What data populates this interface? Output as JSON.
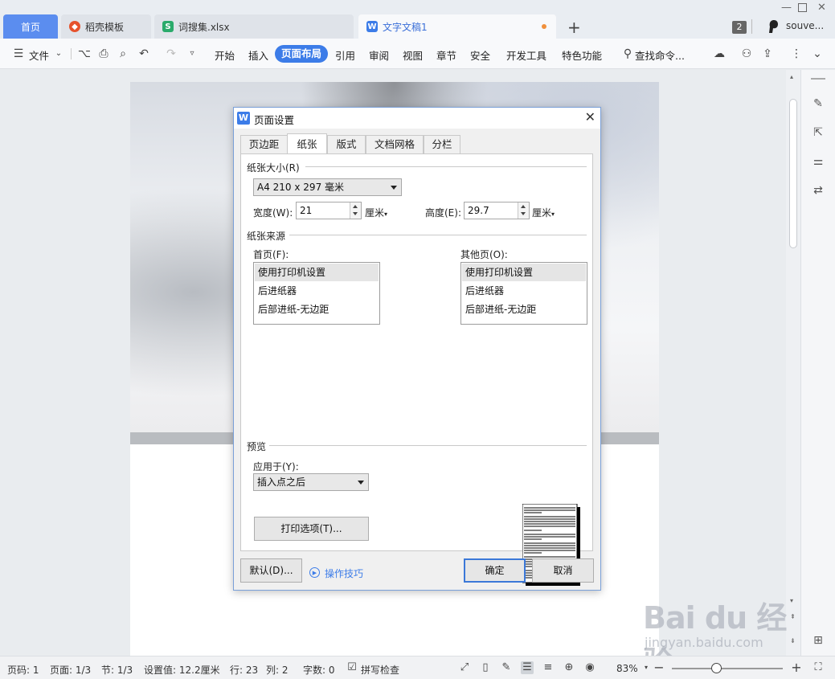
{
  "tabs": {
    "home": "首页",
    "daoke": "稻壳模板",
    "xlsx": "词搜集.xlsx",
    "doc": "文字文稿1",
    "window_count": "2",
    "user": "souve..."
  },
  "ribbon": {
    "file": "文件",
    "items": [
      "开始",
      "插入",
      "页面布局",
      "引用",
      "审阅",
      "视图",
      "章节",
      "安全",
      "开发工具",
      "特色功能"
    ],
    "active": "页面布局",
    "search": "查找命令..."
  },
  "dialog": {
    "title": "页面设置",
    "tabs": [
      "页边距",
      "纸张",
      "版式",
      "文档网格",
      "分栏"
    ],
    "active_tab": "纸张",
    "paper_size_label": "纸张大小(R)",
    "paper_size_value": "A4 210 x 297 毫米",
    "width_label": "宽度(W):",
    "width_value": "21",
    "height_label": "高度(E):",
    "height_value": "29.7",
    "unit": "厘米",
    "paper_source_label": "纸张来源",
    "first_page_label": "首页(F):",
    "other_pages_label": "其他页(O):",
    "source_options": [
      "使用打印机设置",
      "后进纸器",
      "后部进纸-无边距"
    ],
    "preview_label": "预览",
    "apply_to_label": "应用于(Y):",
    "apply_to_value": "插入点之后",
    "print_options_button": "打印选项(T)...",
    "default_button": "默认(D)...",
    "help_link": "操作技巧",
    "ok_button": "确定",
    "cancel_button": "取消"
  },
  "status": {
    "page_num": "页码: 1",
    "pages": "页面: 1/3",
    "section": "节: 1/3",
    "setting": "设置值: 12.2厘米",
    "row": "行: 23",
    "col": "列: 2",
    "word_count": "字数: 0",
    "spell_check": "拼写检查",
    "zoom": "83%",
    "zoom_level": 0.4
  },
  "watermark": {
    "main": "Bai du 经验",
    "sub": "jingyan.baidu.com"
  },
  "colors": {
    "accent": "#3c7ce8",
    "home_tab": "#5b8def"
  }
}
